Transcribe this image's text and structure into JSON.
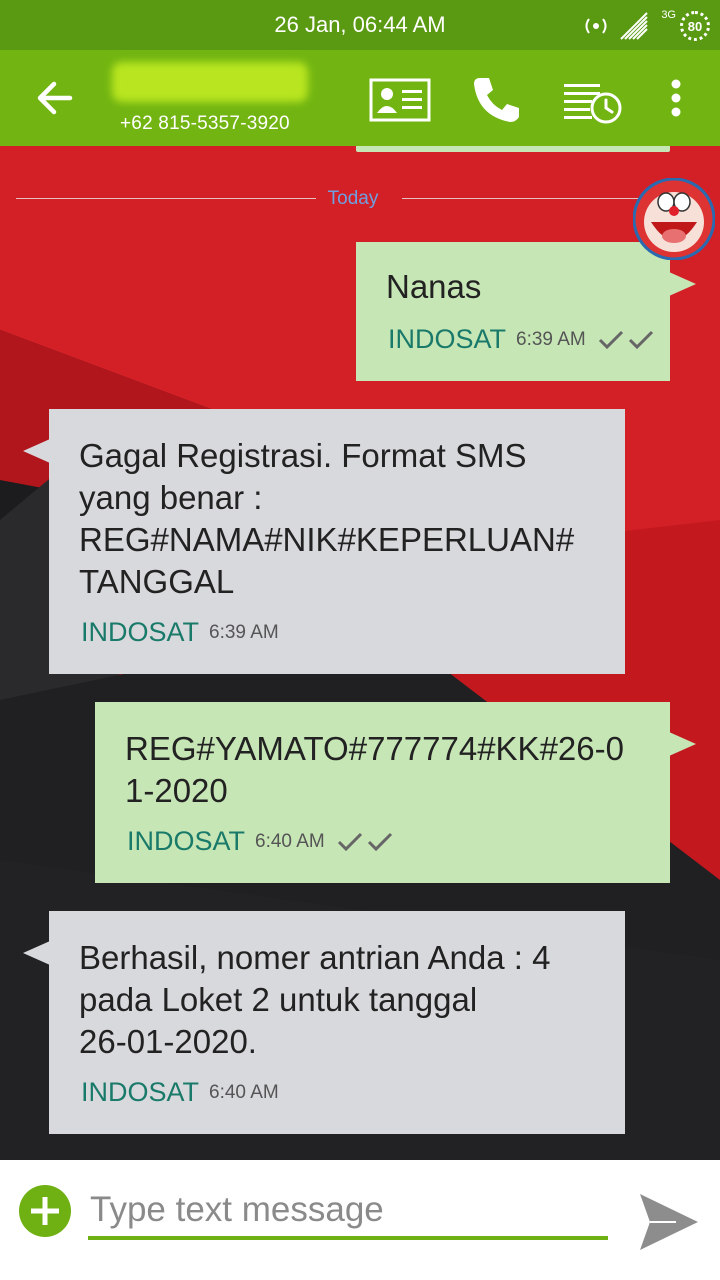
{
  "status_bar": {
    "time": "26 Jan, 06:44 AM",
    "network_type": "3G",
    "battery": "80"
  },
  "header": {
    "contact_number": "+62 815-5357-3920",
    "icons": [
      "back-arrow-icon",
      "contact-card-icon",
      "phone-icon",
      "schedule-icon",
      "overflow-menu-icon"
    ]
  },
  "conversation": {
    "date_separator": "Today",
    "messages": [
      {
        "direction": "out",
        "text": "Nanas",
        "sender": "INDOSAT",
        "time": "6:39 AM",
        "status": "delivered"
      },
      {
        "direction": "in",
        "text": "Gagal Registrasi. Format SMS\nyang benar :\nREG#NAMA#NIK#KEPERLUAN#\nTANGGAL",
        "sender": "INDOSAT",
        "time": "6:39 AM"
      },
      {
        "direction": "out",
        "text": "REG#YAMATO#777774#KK#26-0\n1-2020",
        "sender": "INDOSAT",
        "time": "6:40 AM",
        "status": "delivered"
      },
      {
        "direction": "in",
        "text": "Berhasil, nomer antrian Anda : 4\npada Loket 2 untuk tanggal\n26-01-2020.",
        "sender": "INDOSAT",
        "time": "6:40 AM"
      }
    ]
  },
  "composer": {
    "placeholder": "Type text message",
    "value": ""
  },
  "colors": {
    "status_bar": "#5a9a13",
    "app_bar": "#72b512",
    "outgoing_bubble": "#c7e6b6",
    "incoming_bubble": "#d8d9dd",
    "sender_label": "#1a7a6a",
    "accent": "#6fb012"
  }
}
